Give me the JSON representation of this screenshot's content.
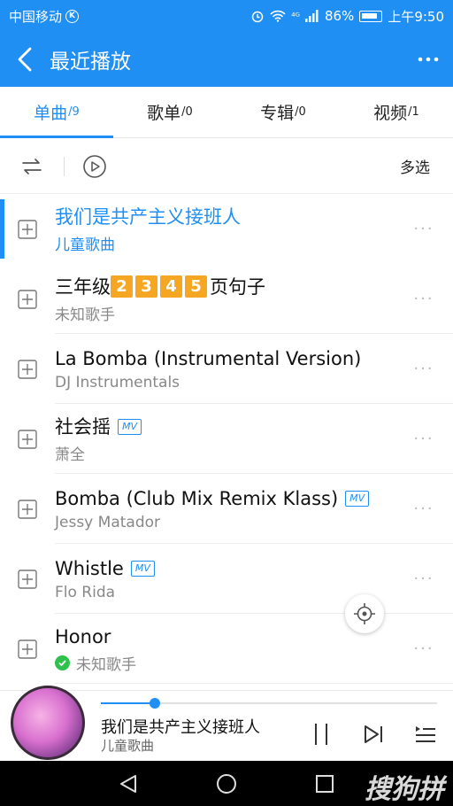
{
  "status": {
    "carrier": "中国移动",
    "k": "K",
    "signal": "⁴ᴳ",
    "battery": "86%",
    "time": "上午9:50"
  },
  "appbar": {
    "title": "最近播放"
  },
  "tabs": [
    {
      "label": "单曲",
      "count": "/9"
    },
    {
      "label": "歌单",
      "count": "/0"
    },
    {
      "label": "专辑",
      "count": "/0"
    },
    {
      "label": "视频",
      "count": "/1"
    }
  ],
  "toolbar": {
    "multi_select": "多选"
  },
  "songs": [
    {
      "title": "我们是共产主义接班人",
      "artist": "儿童歌曲"
    },
    {
      "title_prefix": "三年级",
      "nums": [
        "2",
        "3",
        "4",
        "5"
      ],
      "title_suffix": "页句子",
      "artist": "未知歌手"
    },
    {
      "title": "La Bomba (Instrumental Version)",
      "artist": "DJ Instrumentals"
    },
    {
      "title": "社会摇",
      "artist": "萧全",
      "mv": "MV"
    },
    {
      "title": "Bomba (Club Mix Remix Klass)",
      "artist": "Jessy Matador",
      "mv": "MV"
    },
    {
      "title": "Whistle",
      "artist": "Flo Rida",
      "mv": "MV"
    },
    {
      "title": "Honor",
      "artist": "未知歌手"
    }
  ],
  "player": {
    "title": "我们是共产主义接班人",
    "artist": "儿童歌曲",
    "progress": 0.16
  },
  "watermark": "搜狗拼",
  "colors": {
    "accent": "#1f8ff3",
    "num_badge": "#f5a623",
    "check": "#2fc14b"
  }
}
